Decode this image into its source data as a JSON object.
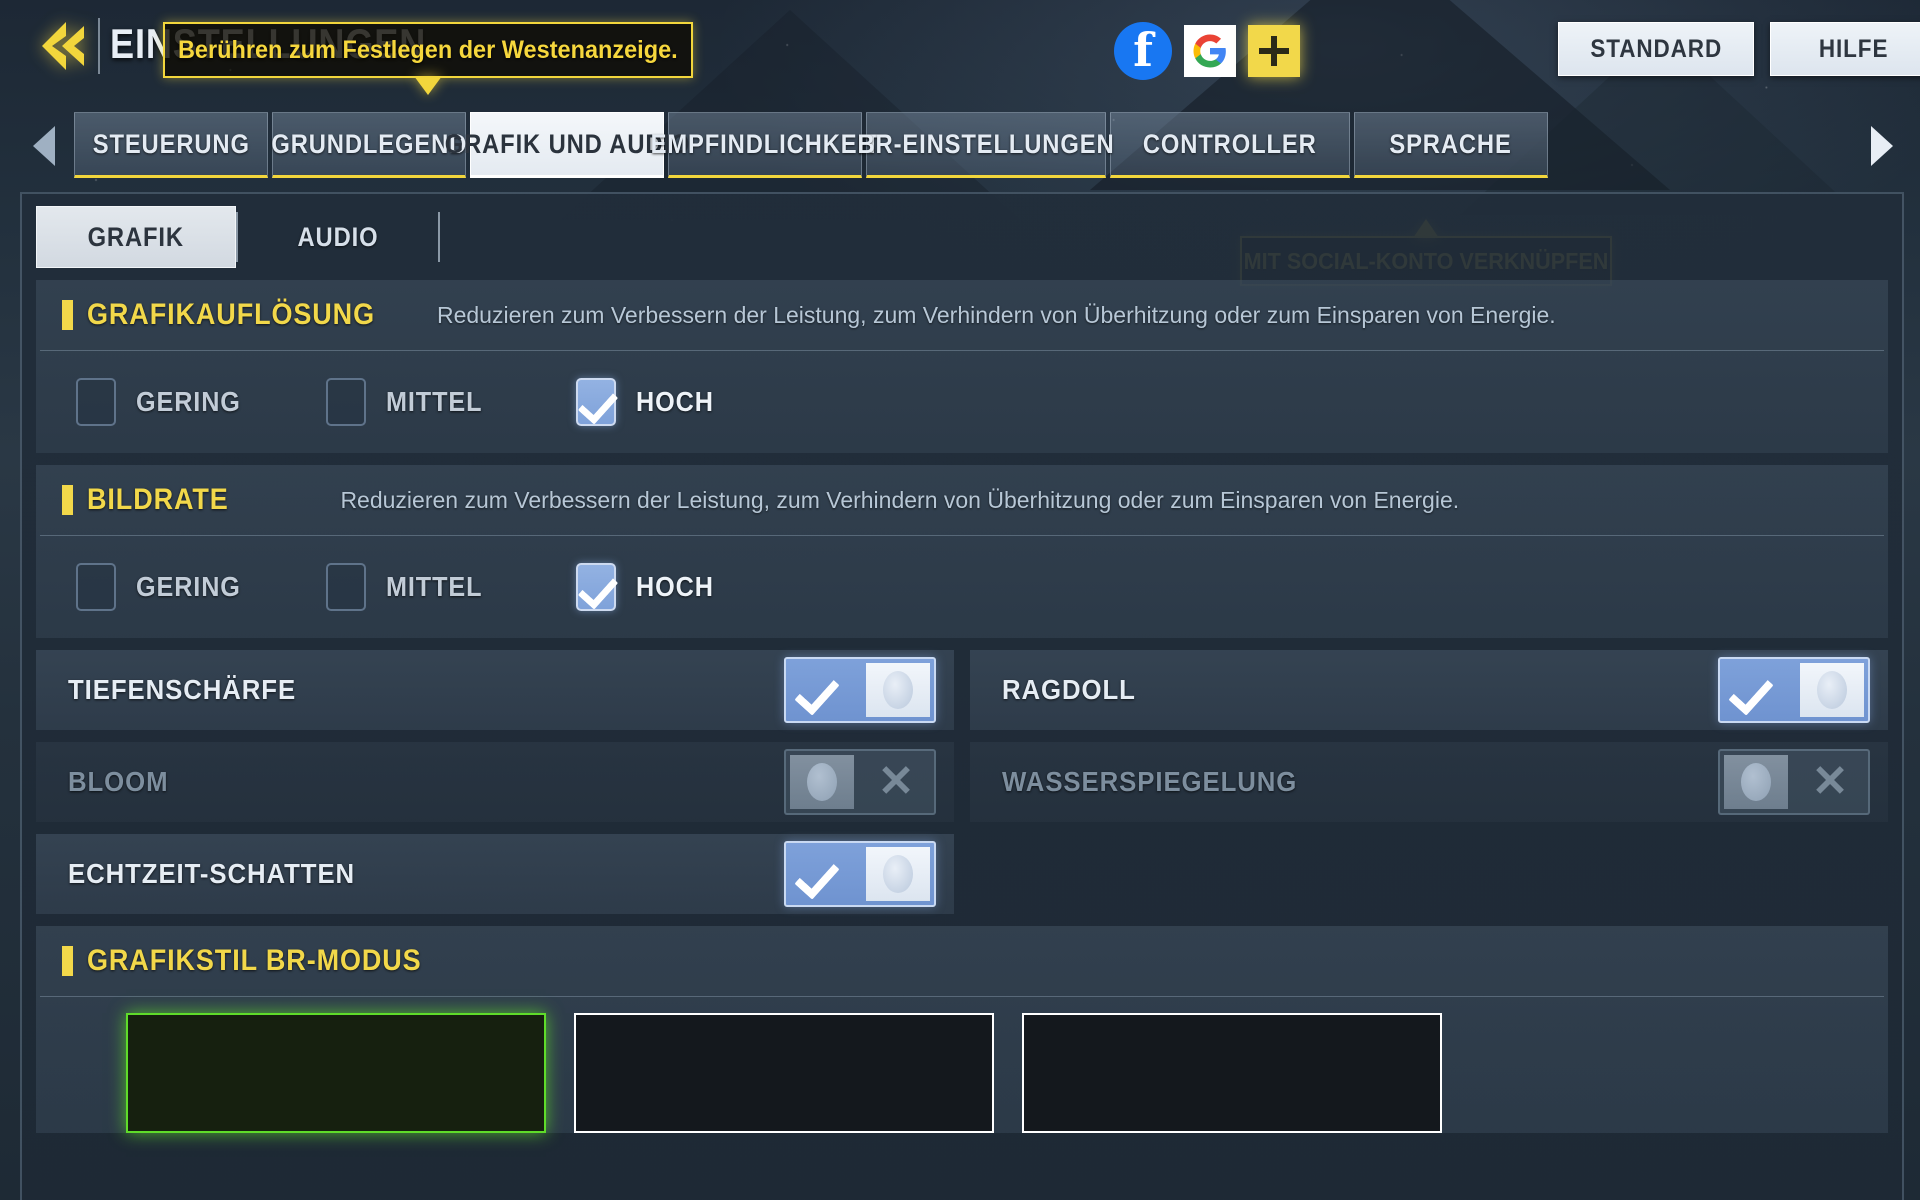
{
  "header": {
    "back_icon": "back-arrow-icon",
    "title": "EINSTELLUNGEN",
    "tooltip_title": "Berühren zum Festlegen der Westenanzeige.",
    "social": [
      {
        "name": "facebook-icon",
        "label": "f"
      },
      {
        "name": "google-icon",
        "label": "G"
      },
      {
        "name": "add-account-icon",
        "label": "+"
      }
    ],
    "buttons": {
      "standard": "STANDARD",
      "help": "HILFE"
    }
  },
  "tabs": {
    "scroll_left_icon": "chevron-left-icon",
    "scroll_right_icon": "chevron-right-icon",
    "tooltip": "MIT SOCIAL-KONTO VERKNÜPFEN",
    "items": [
      {
        "label": "STEUERUNG",
        "active": false
      },
      {
        "label": "GRUNDLEGEND",
        "active": false
      },
      {
        "label": "GRAFIK UND AUDIO",
        "active": true
      },
      {
        "label": "EMPFINDLICHKEIT",
        "active": false
      },
      {
        "label": "BR-EINSTELLUNGEN",
        "active": false
      },
      {
        "label": "CONTROLLER",
        "active": false
      },
      {
        "label": "SPRACHE",
        "active": false
      }
    ]
  },
  "subtabs": [
    {
      "label": "GRAFIK",
      "active": true
    },
    {
      "label": "AUDIO",
      "active": false
    }
  ],
  "groups": [
    {
      "title": "GRAFIKAUFLÖSUNG",
      "description": "Reduzieren zum Verbessern der Leistung, zum Verhindern von Überhitzung oder zum Einsparen von Energie.",
      "options": [
        {
          "label": "GERING",
          "checked": false
        },
        {
          "label": "MITTEL",
          "checked": false
        },
        {
          "label": "HOCH",
          "checked": true
        }
      ]
    },
    {
      "title": "BILDRATE",
      "description": "Reduzieren zum Verbessern der Leistung, zum Verhindern von Überhitzung oder zum Einsparen von Energie.",
      "options": [
        {
          "label": "GERING",
          "checked": false
        },
        {
          "label": "MITTEL",
          "checked": false
        },
        {
          "label": "HOCH",
          "checked": true
        }
      ]
    }
  ],
  "toggles": [
    {
      "label": "TIEFENSCHÄRFE",
      "on": true
    },
    {
      "label": "RAGDOLL",
      "on": true
    },
    {
      "label": "BLOOM",
      "on": false
    },
    {
      "label": "WASSERSPIEGELUNG",
      "on": false
    },
    {
      "label": "ECHTZEIT-SCHATTEN",
      "on": true
    }
  ],
  "br_style": {
    "title": "GRAFIKSTIL BR-MODUS",
    "cards": [
      {
        "selected": true
      },
      {
        "selected": false
      },
      {
        "selected": false
      }
    ]
  }
}
